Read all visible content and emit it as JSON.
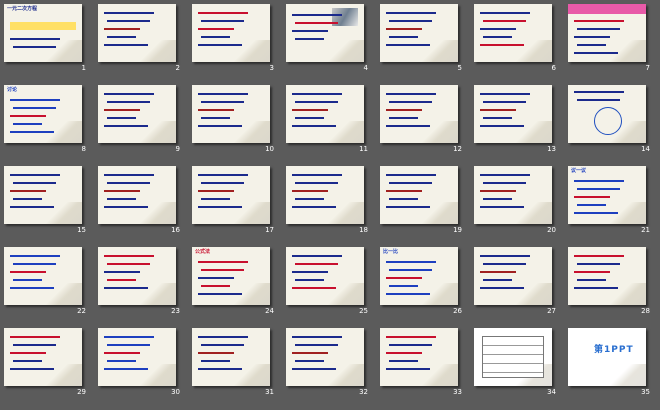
{
  "slides": [
    {
      "n": "1",
      "style": "title",
      "heading": "一元二次方程"
    },
    {
      "n": "2",
      "style": "lines",
      "heading": ""
    },
    {
      "n": "3",
      "style": "lines-red",
      "heading": ""
    },
    {
      "n": "4",
      "style": "photo",
      "heading": ""
    },
    {
      "n": "5",
      "style": "lines",
      "heading": ""
    },
    {
      "n": "6",
      "style": "lines-box",
      "heading": ""
    },
    {
      "n": "7",
      "style": "pink",
      "heading": ""
    },
    {
      "n": "8",
      "style": "blue-text",
      "heading": "讨论"
    },
    {
      "n": "9",
      "style": "lines",
      "heading": ""
    },
    {
      "n": "10",
      "style": "lines",
      "heading": ""
    },
    {
      "n": "11",
      "style": "lines",
      "heading": ""
    },
    {
      "n": "12",
      "style": "lines",
      "heading": ""
    },
    {
      "n": "13",
      "style": "lines",
      "heading": ""
    },
    {
      "n": "14",
      "style": "circle",
      "heading": ""
    },
    {
      "n": "15",
      "style": "lines",
      "heading": ""
    },
    {
      "n": "16",
      "style": "lines",
      "heading": ""
    },
    {
      "n": "17",
      "style": "lines",
      "heading": ""
    },
    {
      "n": "18",
      "style": "lines",
      "heading": ""
    },
    {
      "n": "19",
      "style": "lines",
      "heading": ""
    },
    {
      "n": "20",
      "style": "lines",
      "heading": ""
    },
    {
      "n": "21",
      "style": "blue-text",
      "heading": "议一议"
    },
    {
      "n": "22",
      "style": "blue-text",
      "heading": ""
    },
    {
      "n": "23",
      "style": "red-text",
      "heading": ""
    },
    {
      "n": "24",
      "style": "red-text",
      "heading": "公式法"
    },
    {
      "n": "25",
      "style": "lines-box",
      "heading": ""
    },
    {
      "n": "26",
      "style": "blue-text",
      "heading": "比一比"
    },
    {
      "n": "27",
      "style": "lines",
      "heading": ""
    },
    {
      "n": "28",
      "style": "lines-red",
      "heading": ""
    },
    {
      "n": "29",
      "style": "lines-red",
      "heading": ""
    },
    {
      "n": "30",
      "style": "blue-text",
      "heading": ""
    },
    {
      "n": "31",
      "style": "lines",
      "heading": ""
    },
    {
      "n": "32",
      "style": "lines",
      "heading": ""
    },
    {
      "n": "33",
      "style": "lines-red",
      "heading": ""
    },
    {
      "n": "34",
      "style": "table",
      "heading": ""
    },
    {
      "n": "35",
      "style": "logo",
      "heading": "第1PPT"
    }
  ]
}
